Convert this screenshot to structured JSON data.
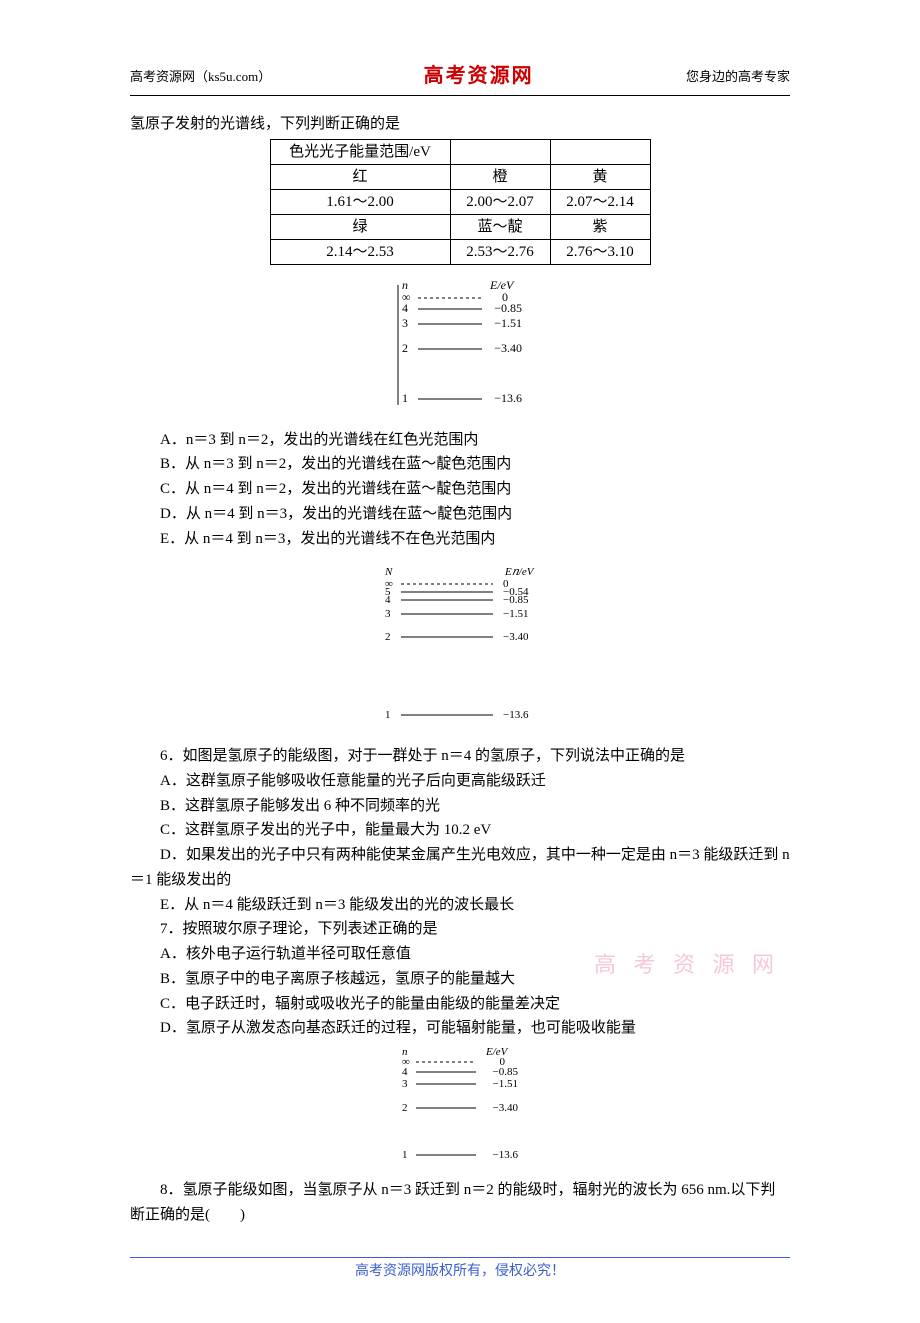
{
  "header": {
    "left": "高考资源网（ks5u.com）",
    "center": "高考资源网",
    "right": "您身边的高考专家"
  },
  "intro_suffix": "氢原子发射的光谱线，下列判断正确的是",
  "color_table": {
    "r1c1": "色光光子能量范围/eV",
    "r1c2": "",
    "r1c3": "",
    "r2c1": "红",
    "r2c2": "橙",
    "r2c3": "黄",
    "r3c1": "1.61～2.00",
    "r3c2": "2.00～2.07",
    "r3c3": "2.07～2.14",
    "r4c1": "绿",
    "r4c2": "蓝～靛",
    "r4c3": "紫",
    "r5c1": "2.14～2.53",
    "r5c2": "2.53～2.76",
    "r5c3": "2.76～3.10"
  },
  "diagram1": {
    "hdr_n": "n",
    "hdr_E": "E/eV",
    "rows": [
      {
        "n": "∞",
        "E": "0",
        "dashed": true
      },
      {
        "n": "4",
        "E": "−0.85"
      },
      {
        "n": "3",
        "E": "−1.51"
      },
      {
        "n": "2",
        "E": "−3.40"
      },
      {
        "n": "1",
        "E": "−13.6"
      }
    ]
  },
  "q5_choices": {
    "A": "A．n＝3 到 n＝2，发出的光谱线在红色光范围内",
    "B": "B．从 n＝3 到 n＝2，发出的光谱线在蓝～靛色范围内",
    "C": "C．从 n＝4 到 n＝2，发出的光谱线在蓝～靛色范围内",
    "D": "D．从 n＝4 到 n＝3，发出的光谱线在蓝～靛色范围内",
    "E": "E．从 n＝4 到 n＝3，发出的光谱线不在色光范围内"
  },
  "diagram2": {
    "hdr_n": "N",
    "hdr_E": "E𝑛/eV",
    "rows": [
      {
        "n": "∞",
        "E": "0",
        "dashed": true
      },
      {
        "n": "5",
        "E": "−0.54"
      },
      {
        "n": "4",
        "E": "−0.85"
      },
      {
        "n": "3",
        "E": "−1.51"
      },
      {
        "n": "2",
        "E": "−3.40"
      },
      {
        "n": "1",
        "E": "−13.6"
      }
    ]
  },
  "q6": {
    "stem": "6．如图是氢原子的能级图，对于一群处于 n＝4 的氢原子，下列说法中正确的是",
    "A": "A．这群氢原子能够吸收任意能量的光子后向更高能级跃迁",
    "B": "B．这群氢原子能够发出 6 种不同频率的光",
    "C": "C．这群氢原子发出的光子中，能量最大为 10.2 eV",
    "D": "D．如果发出的光子中只有两种能使某金属产生光电效应，其中一种一定是由 n＝3 能级跃迁到 n＝1 能级发出的",
    "E": "E．从 n＝4 能级跃迁到 n＝3 能级发出的光的波长最长"
  },
  "q7": {
    "stem": "7．按照玻尔原子理论，下列表述正确的是",
    "A": "A．核外电子运行轨道半径可取任意值",
    "B": "B．氢原子中的电子离原子核越远，氢原子的能量越大",
    "C": "C．电子跃迁时，辐射或吸收光子的能量由能级的能量差决定",
    "D": "D．氢原子从激发态向基态跃迁的过程，可能辐射能量，也可能吸收能量"
  },
  "diagram3": {
    "hdr_n": "n",
    "hdr_E": "E/eV",
    "rows": [
      {
        "n": "∞",
        "E": "0",
        "dashed": true
      },
      {
        "n": "4",
        "E": "−0.85"
      },
      {
        "n": "3",
        "E": "−1.51"
      },
      {
        "n": "2",
        "E": "−3.40"
      },
      {
        "n": "1",
        "E": "−13.6"
      }
    ]
  },
  "q8": {
    "stem": "8．氢原子能级如图，当氢原子从 n＝3 跃迁到 n＝2 的能级时，辐射光的波长为 656 nm.以下判断正确的是(　　)"
  },
  "watermark": "高 考 资 源 网",
  "footer": "高考资源网版权所有，侵权必究！"
}
